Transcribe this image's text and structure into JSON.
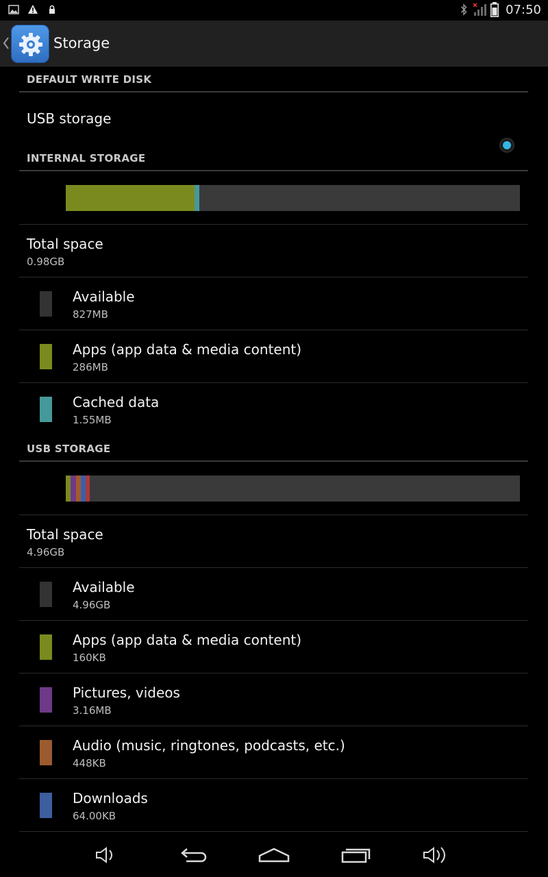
{
  "status_bar": {
    "left_icons": [
      "image-icon",
      "warning-icon",
      "lock-icon"
    ],
    "right_icons": [
      "bluetooth-icon",
      "signal-icon",
      "battery-icon"
    ],
    "time": "07:50"
  },
  "action_bar": {
    "title": "Storage",
    "icon": "gear-icon"
  },
  "default_write_disk": {
    "header": "DEFAULT WRITE DISK",
    "option_label": "USB storage",
    "selected": true,
    "accent": "#33b5e5"
  },
  "internal_storage": {
    "header": "INTERNAL STORAGE",
    "usage_fractions": {
      "apps": 0.284,
      "cached": 0.01
    },
    "total_label": "Total space",
    "total_value": "0.98GB",
    "items": [
      {
        "label": "Available",
        "value": "827MB",
        "color": "#333333"
      },
      {
        "label": "Apps (app data & media content)",
        "value": "286MB",
        "color": "#7b8a1e"
      },
      {
        "label": "Cached data",
        "value": "1.55MB",
        "color": "#46999a"
      }
    ]
  },
  "usb_storage": {
    "header": "USB STORAGE",
    "usage_segment_colors": [
      "#7b8a1e",
      "#6e3a88",
      "#a35a2e",
      "#3a5faa",
      "#aa3a3a"
    ],
    "total_label": "Total space",
    "total_value": "4.96GB",
    "items": [
      {
        "label": "Available",
        "value": "4.96GB",
        "color": "#333333"
      },
      {
        "label": "Apps (app data & media content)",
        "value": "160KB",
        "color": "#7b8a1e"
      },
      {
        "label": "Pictures, videos",
        "value": "3.16MB",
        "color": "#6e3a88"
      },
      {
        "label": "Audio (music, ringtones, podcasts, etc.)",
        "value": "448KB",
        "color": "#9b5b2e"
      },
      {
        "label": "Downloads",
        "value": "64.00KB",
        "color": "#3d5e9f"
      }
    ]
  },
  "nav_bar": {
    "buttons": [
      "volume-down-icon",
      "back-icon",
      "home-icon",
      "recent-apps-icon",
      "volume-up-icon"
    ]
  }
}
